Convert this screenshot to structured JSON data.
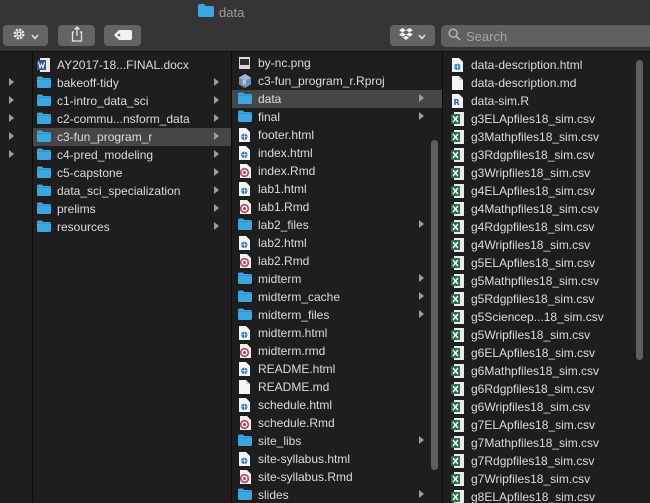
{
  "window": {
    "title": "data"
  },
  "toolbar": {
    "search_placeholder": "Search"
  },
  "col0": {
    "rows": [
      "",
      "",
      "",
      "",
      ""
    ]
  },
  "col1": {
    "items": [
      {
        "label": "AY2017-18...FINAL.docx",
        "icon": "word-doc-icon",
        "kind": "file"
      },
      {
        "label": "bakeoff-tidy",
        "icon": "folder-icon",
        "kind": "folder"
      },
      {
        "label": "c1-intro_data_sci",
        "icon": "folder-icon",
        "kind": "folder"
      },
      {
        "label": "c2-commu...nsform_data",
        "icon": "folder-icon",
        "kind": "folder"
      },
      {
        "label": "c3-fun_program_r",
        "icon": "folder-icon",
        "kind": "folder",
        "selected": true
      },
      {
        "label": "c4-pred_modeling",
        "icon": "folder-icon",
        "kind": "folder"
      },
      {
        "label": "c5-capstone",
        "icon": "folder-icon",
        "kind": "folder"
      },
      {
        "label": "data_sci_specialization",
        "icon": "folder-icon",
        "kind": "folder"
      },
      {
        "label": "prelims",
        "icon": "folder-icon",
        "kind": "folder"
      },
      {
        "label": "resources",
        "icon": "folder-icon",
        "kind": "folder"
      }
    ]
  },
  "col2": {
    "items": [
      {
        "label": "by-nc.png",
        "icon": "image-icon",
        "kind": "file"
      },
      {
        "label": "c3-fun_program_r.Rproj",
        "icon": "rproj-icon",
        "kind": "file"
      },
      {
        "label": "data",
        "icon": "folder-icon",
        "kind": "folder",
        "selected": true
      },
      {
        "label": "final",
        "icon": "folder-icon",
        "kind": "folder"
      },
      {
        "label": "footer.html",
        "icon": "html-icon",
        "kind": "file"
      },
      {
        "label": "index.html",
        "icon": "html-icon",
        "kind": "file"
      },
      {
        "label": "index.Rmd",
        "icon": "rmd-icon",
        "kind": "file"
      },
      {
        "label": "lab1.html",
        "icon": "html-icon",
        "kind": "file"
      },
      {
        "label": "lab1.Rmd",
        "icon": "rmd-icon",
        "kind": "file"
      },
      {
        "label": "lab2_files",
        "icon": "folder-icon",
        "kind": "folder"
      },
      {
        "label": "lab2.html",
        "icon": "html-icon",
        "kind": "file"
      },
      {
        "label": "lab2.Rmd",
        "icon": "rmd-icon",
        "kind": "file"
      },
      {
        "label": "midterm",
        "icon": "folder-icon",
        "kind": "folder"
      },
      {
        "label": "midterm_cache",
        "icon": "folder-icon",
        "kind": "folder"
      },
      {
        "label": "midterm_files",
        "icon": "folder-icon",
        "kind": "folder"
      },
      {
        "label": "midterm.html",
        "icon": "html-icon",
        "kind": "file"
      },
      {
        "label": "midterm.rmd",
        "icon": "rmd-icon",
        "kind": "file"
      },
      {
        "label": "README.html",
        "icon": "html-icon",
        "kind": "file"
      },
      {
        "label": "README.md",
        "icon": "md-icon",
        "kind": "file"
      },
      {
        "label": "schedule.html",
        "icon": "html-icon",
        "kind": "file"
      },
      {
        "label": "schedule.Rmd",
        "icon": "rmd-icon",
        "kind": "file"
      },
      {
        "label": "site_libs",
        "icon": "folder-icon",
        "kind": "folder"
      },
      {
        "label": "site-syllabus.html",
        "icon": "html-icon",
        "kind": "file"
      },
      {
        "label": "site-syllabus.Rmd",
        "icon": "rmd-icon",
        "kind": "file"
      },
      {
        "label": "slides",
        "icon": "folder-icon",
        "kind": "folder"
      }
    ]
  },
  "col3": {
    "items": [
      {
        "label": "data-description.html",
        "icon": "html-icon"
      },
      {
        "label": "data-description.md",
        "icon": "md-icon"
      },
      {
        "label": "data-sim.R",
        "icon": "r-script-icon"
      },
      {
        "label": "g3ELApfiles18_sim.csv",
        "icon": "csv-icon"
      },
      {
        "label": "g3Mathpfiles18_sim.csv",
        "icon": "csv-icon"
      },
      {
        "label": "g3Rdgpfiles18_sim.csv",
        "icon": "csv-icon"
      },
      {
        "label": "g3Wripfiles18_sim.csv",
        "icon": "csv-icon"
      },
      {
        "label": "g4ELApfiles18_sim.csv",
        "icon": "csv-icon"
      },
      {
        "label": "g4Mathpfiles18_sim.csv",
        "icon": "csv-icon"
      },
      {
        "label": "g4Rdgpfiles18_sim.csv",
        "icon": "csv-icon"
      },
      {
        "label": "g4Wripfiles18_sim.csv",
        "icon": "csv-icon"
      },
      {
        "label": "g5ELApfiles18_sim.csv",
        "icon": "csv-icon"
      },
      {
        "label": "g5Mathpfiles18_sim.csv",
        "icon": "csv-icon"
      },
      {
        "label": "g5Rdgpfiles18_sim.csv",
        "icon": "csv-icon"
      },
      {
        "label": "g5Sciencep...18_sim.csv",
        "icon": "csv-icon"
      },
      {
        "label": "g5Wripfiles18_sim.csv",
        "icon": "csv-icon"
      },
      {
        "label": "g6ELApfiles18_sim.csv",
        "icon": "csv-icon"
      },
      {
        "label": "g6Mathpfiles18_sim.csv",
        "icon": "csv-icon"
      },
      {
        "label": "g6Rdgpfiles18_sim.csv",
        "icon": "csv-icon"
      },
      {
        "label": "g6Wripfiles18_sim.csv",
        "icon": "csv-icon"
      },
      {
        "label": "g7ELApfiles18_sim.csv",
        "icon": "csv-icon"
      },
      {
        "label": "g7Mathpfiles18_sim.csv",
        "icon": "csv-icon"
      },
      {
        "label": "g7Rdgpfiles18_sim.csv",
        "icon": "csv-icon"
      },
      {
        "label": "g7Wripfiles18_sim.csv",
        "icon": "csv-icon"
      },
      {
        "label": "g8ELApfiles18_sim.csv",
        "icon": "csv-icon"
      }
    ]
  },
  "colors": {
    "folder": "#3aa7e0",
    "selection": "#464646",
    "excel": "#1f7244",
    "rmd": "#c0405a"
  }
}
